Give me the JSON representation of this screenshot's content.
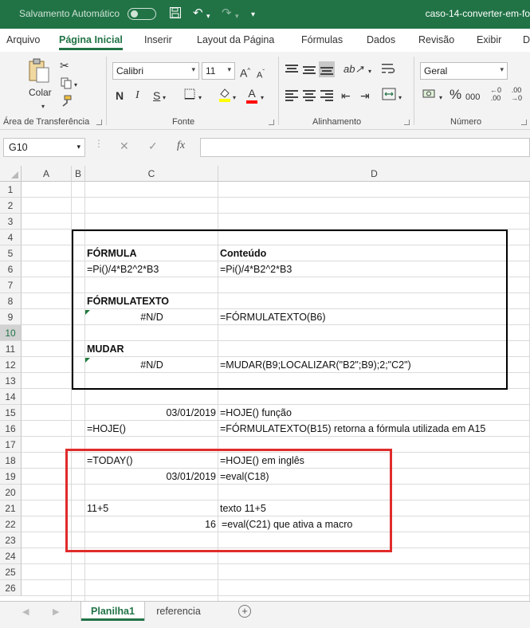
{
  "titlebar": {
    "autosave": "Salvamento Automático",
    "filename": "caso-14-converter-em-fo"
  },
  "tabs": [
    "Arquivo",
    "Página Inicial",
    "Inserir",
    "Layout da Página",
    "Fórmulas",
    "Dados",
    "Revisão",
    "Exibir",
    "D"
  ],
  "ribbon": {
    "paste_label": "Colar",
    "group_clipboard": "Área de Transferência",
    "group_font": "Fonte",
    "group_alignment": "Alinhamento",
    "group_number": "Número",
    "font_name": "Calibri",
    "font_size": "11",
    "number_format": "Geral",
    "bold": "N",
    "italic": "I",
    "underline": "S",
    "grow_font": "A",
    "shrink_font": "A",
    "font_color_letter": "A",
    "percent": "%",
    "thousands": "000",
    "colors": {
      "fill": "#ffff00",
      "font": "#ff0000",
      "brand": "#217346"
    }
  },
  "formula_bar": {
    "name_box": "G10",
    "fx": "fx",
    "cancel": "✕",
    "enter": "✓",
    "content": ""
  },
  "columns": [
    "A",
    "B",
    "C",
    "D"
  ],
  "rows": [
    "1",
    "2",
    "3",
    "4",
    "5",
    "6",
    "7",
    "8",
    "9",
    "10",
    "11",
    "12",
    "13",
    "14",
    "15",
    "16",
    "17",
    "18",
    "19",
    "20",
    "21",
    "22",
    "23",
    "24",
    "25",
    "26"
  ],
  "cells": {
    "C5": "FÓRMULA",
    "D5": "Conteúdo",
    "C6": "=Pi()/4*B2^2*B3",
    "D6": "=Pi()/4*B2^2*B3",
    "C8": "FÓRMULATEXTO",
    "C9": "#N/D",
    "D9": "=FÓRMULATEXTO(B6)",
    "C11": "MUDAR",
    "C12": "#N/D",
    "D12": "=MUDAR(B9;LOCALIZAR(\"B2\";B9);2;\"C2\")",
    "C15": "03/01/2019",
    "D15": "=HOJE() função",
    "C16": "=HOJE()",
    "D16": "=FÓRMULATEXTO(B15) retorna a fórmula utilizada em A15",
    "C18": "=TODAY()",
    "D18": "=HOJE() em inglês",
    "C19": "03/01/2019",
    "D19": "=eval(C18)",
    "C21": "11+5",
    "D21": "texto 11+5",
    "C22": "16",
    "D22": "=eval(C21) que ativa a macro"
  },
  "sheets": [
    "Planilha1",
    "referencia"
  ],
  "add_sheet": "+",
  "selected_row": "10"
}
